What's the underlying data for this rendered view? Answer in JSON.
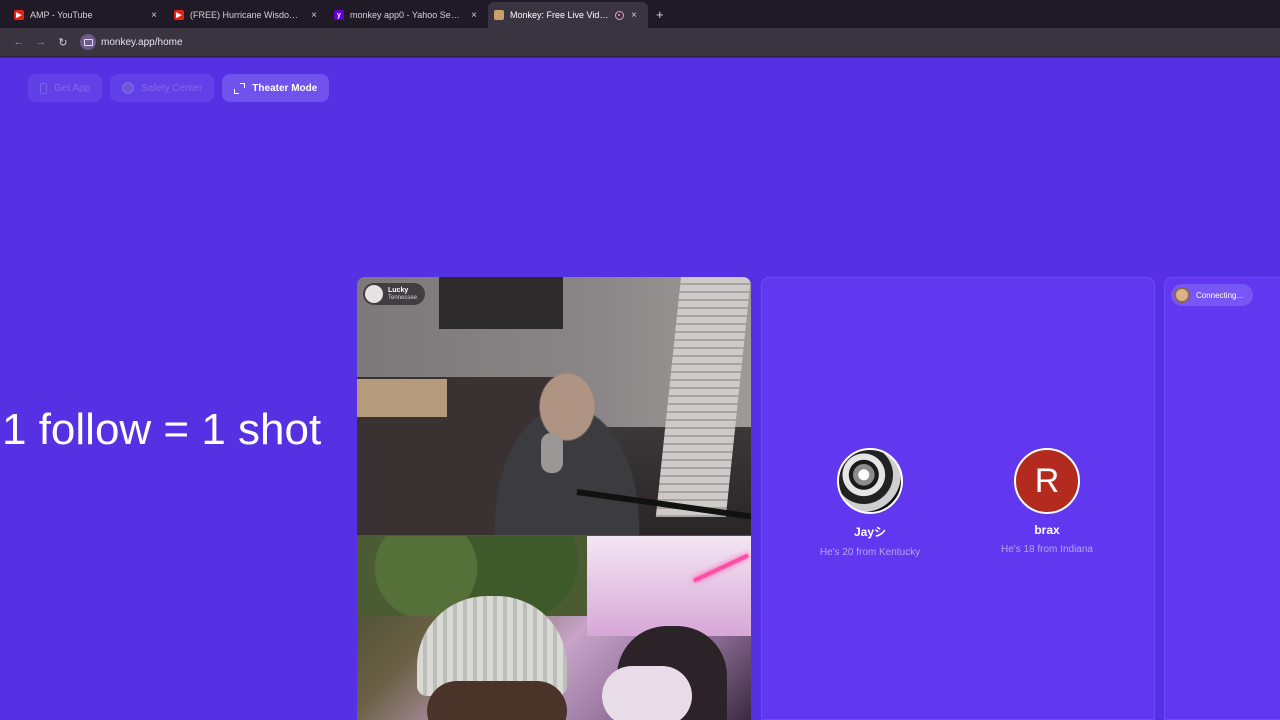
{
  "browser": {
    "tabs": [
      {
        "title": "AMP - YouTube",
        "favicon": "youtube-icon",
        "active": false
      },
      {
        "title": "(FREE) Hurricane Wisdom Type",
        "favicon": "youtube-icon",
        "active": false
      },
      {
        "title": "monkey app0 - Yahoo Search R",
        "favicon": "yahoo-icon",
        "active": false
      },
      {
        "title": "Monkey: Free Live Video Ch",
        "favicon": "monkey-icon",
        "active": true
      }
    ],
    "new_tab": "+",
    "address": "monkey.app/home",
    "close_glyph": "×"
  },
  "toolbar": {
    "get_app": "Get App",
    "safety_center": "Safety Center",
    "theater_mode": "Theater Mode"
  },
  "overlay_text": "1 follow = 1 shot",
  "video": {
    "user_name": "Lucky",
    "user_location": "Tennessee"
  },
  "candidates": [
    {
      "name": "Jayシ",
      "desc": "He's 20 from Kentucky",
      "avatar": "photo"
    },
    {
      "name": "brax",
      "desc": "He's 18 from Indiana",
      "avatar_letter": "R"
    }
  ],
  "connecting": "Connecting...",
  "colors": {
    "page_bg": "#5631e3",
    "panel_bg": "#6138ef",
    "brax_avatar": "#b32a1e"
  }
}
